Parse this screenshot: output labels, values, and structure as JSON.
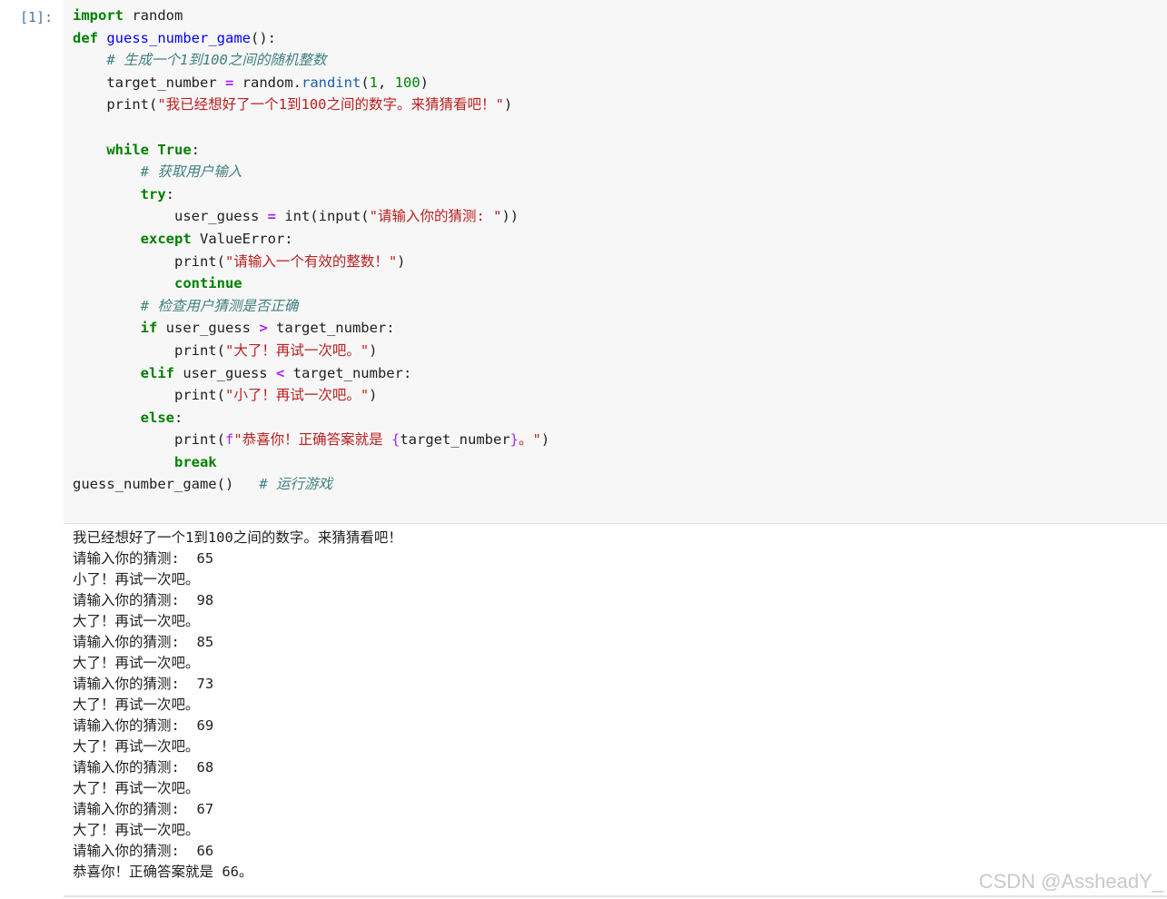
{
  "cell": {
    "prompt": "[1]:",
    "code_lines": [
      "import random",
      "def guess_number_game():",
      "    # 生成一个1到100之间的随机整数",
      "    target_number = random.randint(1, 100)",
      "    print(\"我已经想好了一个1到100之间的数字。来猜猜看吧！\")",
      "",
      "    while True:",
      "        # 获取用户输入",
      "        try:",
      "            user_guess = int(input(\"请输入你的猜测: \"))",
      "        except ValueError:",
      "            print(\"请输入一个有效的整数！\")",
      "            continue",
      "        # 检查用户猜测是否正确",
      "        if user_guess > target_number:",
      "            print(\"大了！再试一次吧。\")",
      "        elif user_guess < target_number:",
      "            print(\"小了！再试一次吧。\")",
      "        else:",
      "            print(f\"恭喜你！正确答案就是 {target_number}。\")",
      "            break",
      "guess_number_game()   # 运行游戏"
    ]
  },
  "output": {
    "lines": [
      "我已经想好了一个1到100之间的数字。来猜猜看吧！",
      "请输入你的猜测:  65",
      "小了！再试一次吧。",
      "请输入你的猜测:  98",
      "大了！再试一次吧。",
      "请输入你的猜测:  85",
      "大了！再试一次吧。",
      "请输入你的猜测:  73",
      "大了！再试一次吧。",
      "请输入你的猜测:  69",
      "大了！再试一次吧。",
      "请输入你的猜测:  68",
      "大了！再试一次吧。",
      "请输入你的猜测:  67",
      "大了！再试一次吧。",
      "请输入你的猜测:  66",
      "恭喜你！正确答案就是 66。"
    ]
  },
  "watermark": "CSDN @AssheadY_",
  "colors": {
    "keyword": "#008000",
    "string": "#ba2121",
    "comment": "#408080",
    "operator": "#aa22ff",
    "prompt": "#4a74a8",
    "input_bg": "#f7f7f7"
  }
}
